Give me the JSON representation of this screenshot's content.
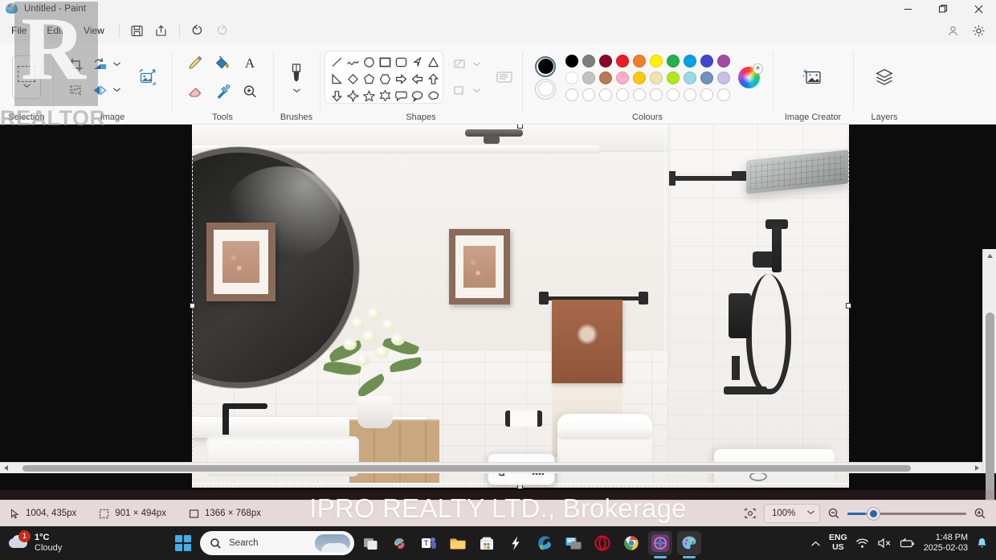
{
  "window": {
    "title": "Untitled - Paint",
    "app_icon": "paint-palette-icon",
    "controls": {
      "minimize": "minimize-icon",
      "restore": "restore-icon",
      "close": "close-icon"
    }
  },
  "menu": {
    "items": [
      "File",
      "Edit",
      "View"
    ],
    "quick_actions": [
      "save-icon",
      "share-icon",
      "undo-icon",
      "redo-icon"
    ],
    "right_actions": [
      "account-icon",
      "settings-gear-icon"
    ]
  },
  "ribbon": {
    "groups": [
      {
        "label": "Selection"
      },
      {
        "label": "Image"
      },
      {
        "label": "Tools"
      },
      {
        "label": "Brushes"
      },
      {
        "label": "Shapes"
      },
      {
        "label": "Colours"
      },
      {
        "label": "Image Creator"
      },
      {
        "label": "Layers"
      }
    ],
    "selection": {
      "tool": "rectangular-selection-icon",
      "expand": "chevron-down-icon"
    },
    "image_tools": [
      "crop-icon",
      "resize-skew-icon",
      "rotate-icon",
      "flip-icon",
      "remove-background-icon"
    ],
    "tools": [
      "pencil-icon",
      "fill-bucket-icon",
      "text-icon",
      "eraser-icon",
      "eyedropper-icon",
      "magnifier-icon"
    ],
    "brushes": {
      "icon": "brush-icon",
      "expand": "chevron-down-icon"
    },
    "shapes": [
      "line",
      "curve",
      "oval",
      "rectangle",
      "rounded-rectangle",
      "polygon",
      "triangle",
      "right-triangle",
      "diamond",
      "pentagon",
      "hexagon",
      "right-arrow",
      "left-arrow",
      "up-arrow",
      "down-arrow",
      "four-point-star",
      "five-point-star",
      "six-point-star",
      "rounded-callout",
      "oval-callout",
      "cloud-callout"
    ],
    "shape_options": [
      "outline-icon",
      "fill-icon"
    ]
  },
  "colours": {
    "primary": "#000000",
    "secondary": "#ffffff",
    "row1": [
      "#000000",
      "#7f7f7f",
      "#88072a",
      "#ed1c24",
      "#f07f29",
      "#fff200",
      "#22b14c",
      "#00a2e8",
      "#3f48cc",
      "#a349a4"
    ],
    "row2": [
      "#ffffff",
      "#c3c3c3",
      "#b97a57",
      "#ffaec9",
      "#ffc90e",
      "#efe4b0",
      "#b5e61d",
      "#99d9ea",
      "#7092be",
      "#c8bfe7"
    ],
    "row3": [
      "empty",
      "empty",
      "empty",
      "empty",
      "empty",
      "empty",
      "empty",
      "empty",
      "empty",
      "empty"
    ],
    "picker": "colour-wheel-icon"
  },
  "canvas": {
    "floating_toolbar": [
      "generative-erase-icon",
      "remove-background-icon"
    ],
    "selection_handles": 4
  },
  "statusbar": {
    "cursor_position": "1004, 435px",
    "selection_size": "901 × 494px",
    "image_size": "1366 × 768px",
    "fit_icon": "fit-to-window-icon",
    "zoom_value": "100%",
    "zoom_out_icon": "zoom-out-icon",
    "zoom_in_icon": "zoom-in-icon"
  },
  "watermarks": {
    "logo_letter": "R",
    "logo_text": "REALTOR",
    "bottom_text": "IPRO REALTY LTD., Brokerage"
  },
  "taskbar": {
    "weather": {
      "temperature": "1°C",
      "condition": "Cloudy",
      "badge": "1"
    },
    "start": "start-windows-icon",
    "search": {
      "placeholder": "Search",
      "icon": "search-icon"
    },
    "apps": [
      "task-view-icon",
      "copilot-icon",
      "microsoft-teams-icon",
      "file-explorer-icon",
      "microsoft-store-icon",
      "lightning-app-icon",
      "microsoft-edge-icon",
      "remote-desktop-icon",
      "opera-browser-icon",
      "google-chrome-icon",
      "purple-app-icon",
      "paint-app-icon"
    ],
    "tray": {
      "overflow": "chevron-up-icon",
      "language": [
        "ENG",
        "US"
      ],
      "wifi": "wifi-icon",
      "volume": "volume-muted-icon",
      "battery": "battery-icon",
      "time": "1:48 PM",
      "date": "2025-02-03",
      "notifications": "bell-icon"
    }
  }
}
